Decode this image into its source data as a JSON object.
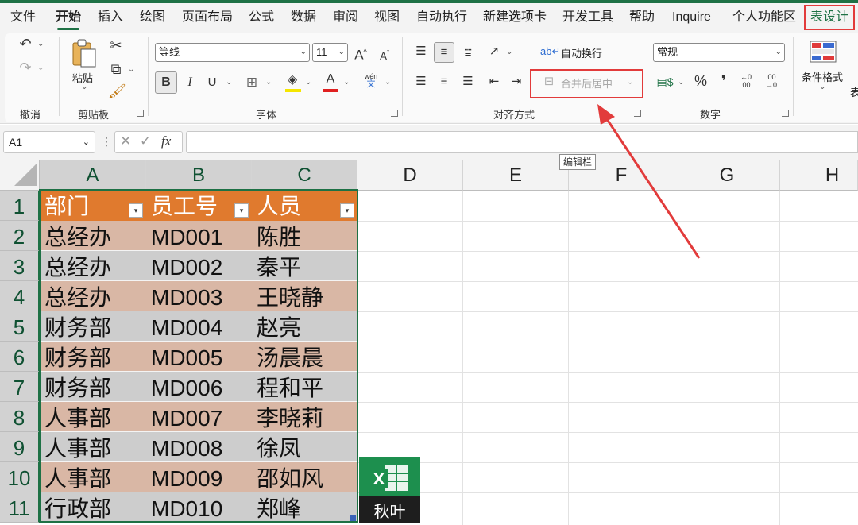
{
  "menu": {
    "tabs": [
      "文件",
      "开始",
      "插入",
      "绘图",
      "页面布局",
      "公式",
      "数据",
      "审阅",
      "视图",
      "自动执行",
      "新建选项卡",
      "开发工具",
      "帮助",
      "Inquire",
      "个人功能区",
      "表设计"
    ],
    "active": "开始",
    "highlighted": "表设计"
  },
  "ribbon": {
    "undo_group": "撤消",
    "clipboard": {
      "paste_label": "粘贴",
      "group": "剪贴板"
    },
    "font": {
      "name": "等线",
      "size": "11",
      "group": "字体",
      "bold": "B",
      "italic": "I",
      "underline": "U",
      "font_color_letter": "A",
      "grow": "A",
      "shrink": "A",
      "phonetic_top": "wén",
      "phonetic_bottom": "文"
    },
    "alignment": {
      "wrap_text": "自动换行",
      "merge_center": "合并后居中",
      "group": "对齐方式"
    },
    "number": {
      "format": "常规",
      "group": "数字",
      "percent": "%",
      "comma": "❜",
      "inc_decimal": "←0\n.00",
      "dec_decimal": ".00\n→0"
    },
    "styles": {
      "conditional_format": "条件格式",
      "clipped_label": "表"
    }
  },
  "formula_bar": {
    "name_box": "A1",
    "fx": "fx",
    "tooltip": "编辑栏",
    "value": ""
  },
  "sheet": {
    "columns": [
      "A",
      "B",
      "C",
      "D",
      "E",
      "F",
      "G",
      "H"
    ],
    "rows": [
      "1",
      "2",
      "3",
      "4",
      "5",
      "6",
      "7",
      "8",
      "9",
      "10",
      "11"
    ],
    "table_headers": [
      "部门",
      "员工号",
      "人员"
    ],
    "table_rows": [
      [
        "总经办",
        "MD001",
        "陈胜"
      ],
      [
        "总经办",
        "MD002",
        "秦平"
      ],
      [
        "总经办",
        "MD003",
        "王晓静"
      ],
      [
        "财务部",
        "MD004",
        "赵亮"
      ],
      [
        "财务部",
        "MD005",
        "汤晨晨"
      ],
      [
        "财务部",
        "MD006",
        "程和平"
      ],
      [
        "人事部",
        "MD007",
        "李晓莉"
      ],
      [
        "人事部",
        "MD008",
        "徐凤"
      ],
      [
        "人事部",
        "MD009",
        "邵如风"
      ],
      [
        "行政部",
        "MD010",
        "郑峰"
      ]
    ],
    "band_colors": [
      "#d9b7a5",
      "#cdcdcd"
    ],
    "header_color": "#e07a2e",
    "accent_color": "#1e7145"
  },
  "watermark": {
    "text": "秋叶",
    "letter": "X"
  }
}
